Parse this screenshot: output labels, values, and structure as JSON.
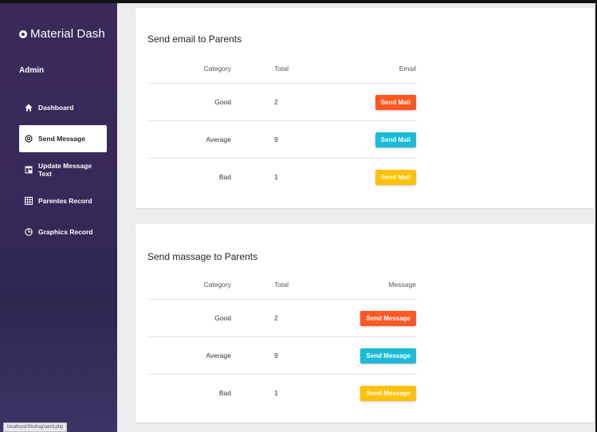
{
  "colors": {
    "orange": "#ff5722",
    "cyan": "#1cbcd8",
    "amber": "#ffc107",
    "sidebar": "#37295a"
  },
  "sidebar": {
    "brand": "Material Dash",
    "role": "Admin",
    "items": [
      {
        "label": "Dashboard",
        "icon": "home-icon",
        "active": false
      },
      {
        "label": "Send Message",
        "icon": "at-icon",
        "active": true
      },
      {
        "label": "Update Message Text",
        "icon": "window-icon",
        "active": false
      },
      {
        "label": "Parentes Record",
        "icon": "grid-icon",
        "active": false
      },
      {
        "label": "Graphics Record",
        "icon": "chart-icon",
        "active": false
      }
    ]
  },
  "status_url": "localhost/Shohaj/send.php",
  "email_card": {
    "title": "Send email to Parents",
    "headers": {
      "category": "Category",
      "total": "Total",
      "action": "Email"
    },
    "rows": [
      {
        "category": "Good",
        "total": "2",
        "button": "Send Mail",
        "color": "#ff5722"
      },
      {
        "category": "Average",
        "total": "9",
        "button": "Send Mail",
        "color": "#1cbcd8"
      },
      {
        "category": "Bad",
        "total": "1",
        "button": "Send Mail",
        "color": "#ffc107"
      }
    ]
  },
  "message_card": {
    "title": "Send massage to Parents",
    "headers": {
      "category": "Category",
      "total": "Total",
      "action": "Message"
    },
    "rows": [
      {
        "category": "Good",
        "total": "2",
        "button": "Send Message",
        "color": "#ff5722"
      },
      {
        "category": "Average",
        "total": "9",
        "button": "Send Message",
        "color": "#1cbcd8"
      },
      {
        "category": "Bad",
        "total": "1",
        "button": "Send Message",
        "color": "#ffc107"
      }
    ]
  }
}
